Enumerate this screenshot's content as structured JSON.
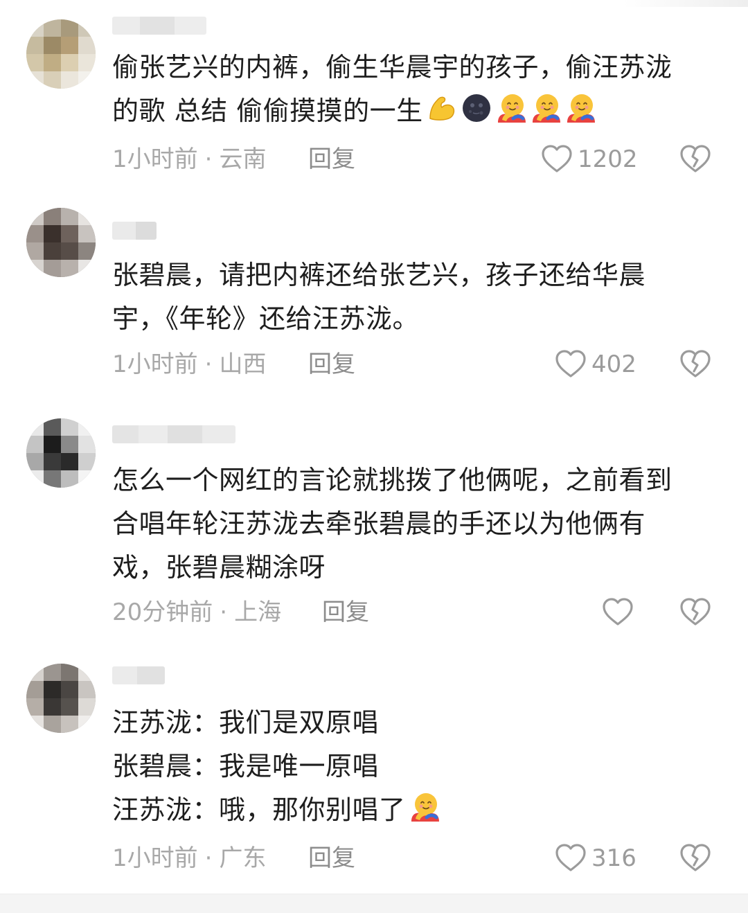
{
  "comments": [
    {
      "text_lines": [
        "偷张艺兴的内裤，偷生华晨宇的孩子，偷汪苏泷",
        "的歌 总结 偷偷摸摸的一生"
      ],
      "emojis": [
        "flexed-biceps-icon",
        "new-moon-face-icon",
        "hugging-face-icon",
        "hugging-face-icon",
        "hugging-face-icon"
      ],
      "time": "1小时前",
      "location": "云南",
      "reply_label": "回复",
      "likes": "1202"
    },
    {
      "text_lines": [
        "张碧晨，请把内裤还给张艺兴，孩子还给华晨",
        "宇，《年轮》还给汪苏泷。"
      ],
      "time": "1小时前",
      "location": "山西",
      "reply_label": "回复",
      "likes": "402"
    },
    {
      "text_lines": [
        "怎么一个网红的言论就挑拨了他俩呢，之前看到",
        "合唱年轮汪苏泷去牵张碧晨的手还以为他俩有",
        "戏，张碧晨糊涂呀"
      ],
      "time": "20分钟前",
      "location": "上海",
      "reply_label": "回复",
      "likes": ""
    },
    {
      "text_lines": [
        "汪苏泷：我们是双原唱",
        "张碧晨：我是唯一原唱",
        "汪苏泷：哦，那你别唱了"
      ],
      "emojis": [
        "hugging-face-icon"
      ],
      "time": "1小时前",
      "location": "广东",
      "reply_label": "回复",
      "likes": "316"
    }
  ],
  "separator": "·",
  "colors": {
    "text": "#1e1e1e",
    "meta": "#a8a8a8",
    "icon": "#9b9b9b"
  }
}
